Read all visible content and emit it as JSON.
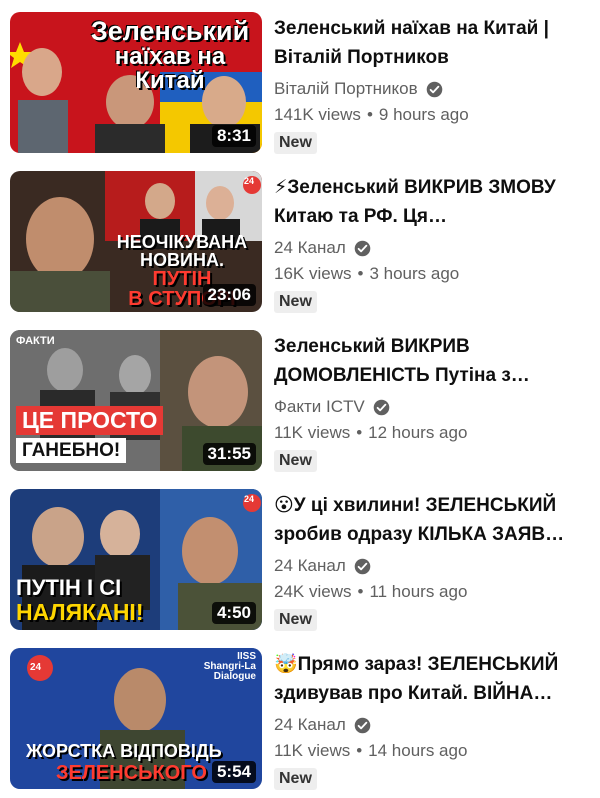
{
  "videos": [
    {
      "title": "Зеленський наїхав на Китай | Віталій Портников",
      "channel": "Віталій Портников",
      "views": "141K views",
      "age": "9 hours ago",
      "badge": "New",
      "duration": "8:31",
      "thumb_text": [
        "Зеленський",
        "наїхав на Китай"
      ]
    },
    {
      "title": "⚡Зеленський ВИКРИВ ЗМОВУ Китаю та РФ. Ця…",
      "channel": "24 Канал",
      "views": "16K views",
      "age": "3 hours ago",
      "badge": "New",
      "duration": "23:06",
      "thumb_text": [
        "НЕОЧІКУВАНА",
        "НОВИНА.",
        "ПУТІН",
        "В СТУПОРІ"
      ],
      "thumb_logo": "24"
    },
    {
      "title": "Зеленський ВИКРИВ ДОМОВЛЕНІСТЬ Путіна з…",
      "channel": "Факти ICTV",
      "views": "11K views",
      "age": "12 hours ago",
      "badge": "New",
      "duration": "31:55",
      "thumb_text": [
        "ЦЕ ПРОСТО",
        "ГАНЕБНО!"
      ],
      "thumb_logo": "ФАКТИ"
    },
    {
      "title": "😮У ці хвилини! ЗЕЛЕНСЬКИЙ зробив одразу КІЛЬКА ЗАЯВ…",
      "channel": "24 Канал",
      "views": "24K views",
      "age": "11 hours ago",
      "badge": "New",
      "duration": "4:50",
      "thumb_text": [
        "ПУТІН І СІ",
        "НАЛЯКАНІ!"
      ],
      "thumb_logo": "24"
    },
    {
      "title": "🤯Прямо зараз! ЗЕЛЕНСЬКИЙ здивував про Китай. ВІЙНА…",
      "channel": "24 Канал",
      "views": "11K views",
      "age": "14 hours ago",
      "badge": "New",
      "duration": "5:54",
      "thumb_text": [
        "ЖОРСТКА ВІДПОВІДЬ",
        "ЗЕЛЕНСЬКОГО"
      ],
      "thumb_logo": "24",
      "thumb_sign": [
        "IISS",
        "Shangri-La",
        "Dialogue"
      ]
    }
  ],
  "meta_separator": "•",
  "colors": {
    "title": "#0f0f0f",
    "secondary": "#606060",
    "badge_bg": "#eeeeee"
  }
}
